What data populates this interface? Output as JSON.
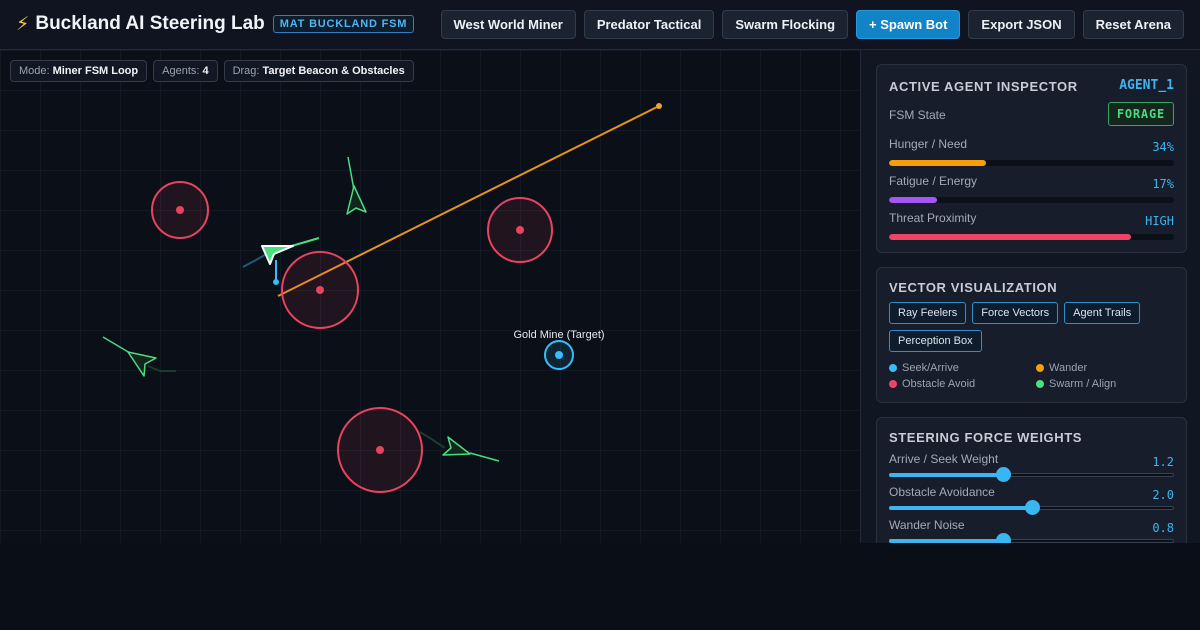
{
  "app": {
    "title": "Buckland AI Steering Lab",
    "badge": "MAT BUCKLAND FSM"
  },
  "toolbar": {
    "buttons": [
      {
        "label": "West World Miner"
      },
      {
        "label": "Predator Tactical"
      },
      {
        "label": "Swarm Flocking"
      },
      {
        "label": "+ Spawn Bot"
      },
      {
        "label": "Export JSON"
      },
      {
        "label": "Reset Arena"
      }
    ]
  },
  "status": {
    "mode_label": "Mode:",
    "mode_value": "Miner FSM Loop",
    "agents_label": "Agents:",
    "agents_value": "4",
    "drag_label": "Drag:",
    "drag_value": "Target Beacon & Obstacles"
  },
  "arena": {
    "target_label": "Gold Mine (Target)"
  },
  "inspector": {
    "title": "ACTIVE AGENT INSPECTOR",
    "agent_id": "AGENT_1",
    "fsm_label": "FSM State",
    "fsm_state": "FORAGE",
    "stats": [
      {
        "label": "Hunger / Need",
        "value": "34%",
        "fraction": 0.34,
        "color": "#f59e0b"
      },
      {
        "label": "Fatigue / Energy",
        "value": "17%",
        "fraction": 0.17,
        "color": "#a855f7"
      },
      {
        "label": "Threat Proximity",
        "value": "HIGH",
        "fraction": 0.85,
        "color": "#ef4565"
      }
    ]
  },
  "vectors": {
    "title": "VECTOR VISUALIZATION",
    "toggles": [
      {
        "label": "Ray Feelers"
      },
      {
        "label": "Force Vectors"
      },
      {
        "label": "Agent Trails"
      },
      {
        "label": "Perception Box"
      }
    ],
    "legend": [
      {
        "label": "Seek/Arrive",
        "color": "#38bdf8"
      },
      {
        "label": "Wander",
        "color": "#f59e0b"
      },
      {
        "label": "Obstacle Avoid",
        "color": "#ef4565"
      },
      {
        "label": "Swarm / Align",
        "color": "#4ade80"
      }
    ]
  },
  "weights": {
    "title": "STEERING FORCE WEIGHTS",
    "sliders": [
      {
        "label": "Arrive / Seek Weight",
        "value": "1.2",
        "fraction": 0.4
      },
      {
        "label": "Obstacle Avoidance",
        "value": "2.0",
        "fraction": 0.5
      },
      {
        "label": "Wander Noise",
        "value": "0.8",
        "fraction": 0.4
      }
    ]
  },
  "colors": {
    "accent": "#3fb4ef",
    "obstacle": "#ef4565",
    "agent": "#4ade80",
    "wander": "#f59e0b"
  }
}
